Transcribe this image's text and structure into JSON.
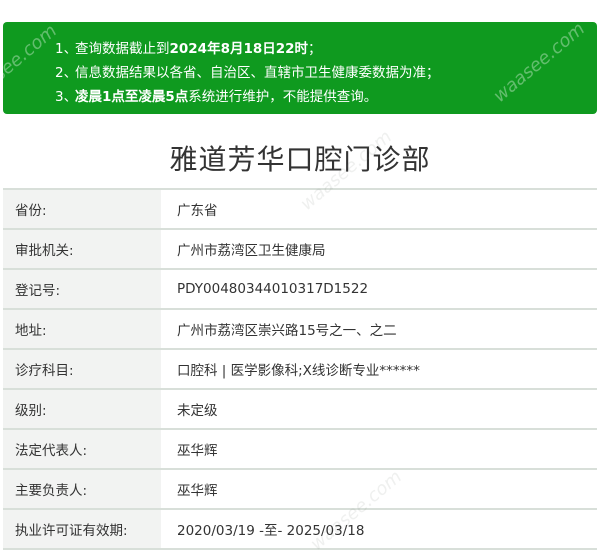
{
  "notice": {
    "items": [
      {
        "num": "1、",
        "pre": "查询数据截止到",
        "bold": "2024年8月18日22时",
        "post": "；"
      },
      {
        "num": "2、",
        "pre": "信息数据结果以各省、自治区、直辖市卫生健康委数据为准；",
        "bold": "",
        "post": ""
      },
      {
        "num": "3、",
        "pre": "",
        "bold": "凌晨1点至凌晨5点",
        "post": "系统进行维护，不能提供查询。"
      }
    ]
  },
  "title": "雅道芳华口腔门诊部",
  "rows": [
    {
      "label": "省份:",
      "value": "广东省"
    },
    {
      "label": "审批机关:",
      "value": "广州市荔湾区卫生健康局"
    },
    {
      "label": "登记号:",
      "value": "PDY00480344010317D1522"
    },
    {
      "label": "地址:",
      "value": "广州市荔湾区崇兴路15号之一、之二"
    },
    {
      "label": "诊疗科目:",
      "value": "口腔科 | 医学影像科;X线诊断专业******"
    },
    {
      "label": "级别:",
      "value": "未定级"
    },
    {
      "label": "法定代表人:",
      "value": "巫华辉"
    },
    {
      "label": "主要负责人:",
      "value": "巫华辉"
    },
    {
      "label": "执业许可证有效期:",
      "value": "2020/03/19 -至- 2025/03/18"
    }
  ],
  "watermark": "waasee.com",
  "colors": {
    "notice_bg": "#0f9a1f",
    "label_bg": "#f2f3f2",
    "border": "#d8dfd9"
  }
}
